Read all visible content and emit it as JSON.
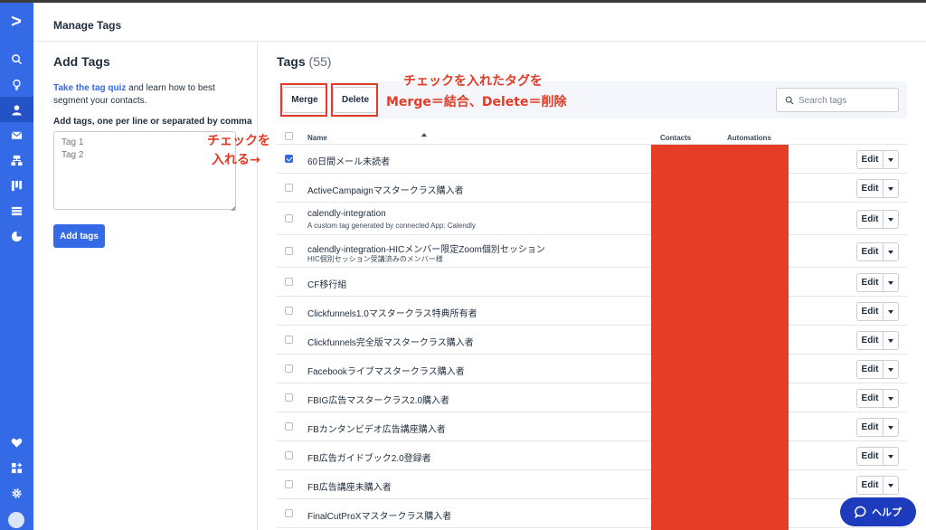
{
  "header": {
    "title": "Manage Tags"
  },
  "add_tags": {
    "title": "Add Tags",
    "quiz_link": "Take the tag quiz",
    "desc_rest": " and learn how to best segment your contacts.",
    "input_label": "Add tags, one per line or separated by comma",
    "placeholder": "Tag 1\nTag 2",
    "button": "Add tags"
  },
  "tags": {
    "title": "Tags",
    "count": "(55)",
    "merge_label": "Merge",
    "delete_label": "Delete",
    "search_placeholder": "Search tags",
    "columns": {
      "name": "Name",
      "contacts": "Contacts",
      "automations": "Automations"
    },
    "edit_label": "Edit",
    "rows": [
      {
        "name": "60日間メール未読者",
        "desc": "",
        "checked": true
      },
      {
        "name": "ActiveCampaignマスタークラス購入者",
        "desc": "",
        "checked": false
      },
      {
        "name": "calendly-integration",
        "desc": "A custom tag generated by connected App: Calendly",
        "checked": false
      },
      {
        "name": "calendly-integration-HICメンバー限定Zoom個別セッション",
        "desc": "HIC個別セッション受講済みのメンバー様",
        "checked": false
      },
      {
        "name": "CF移行組",
        "desc": "",
        "checked": false
      },
      {
        "name": "Clickfunnels1.0マスタークラス特典所有者",
        "desc": "",
        "checked": false
      },
      {
        "name": "Clickfunnels完全版マスタークラス購入者",
        "desc": "",
        "checked": false
      },
      {
        "name": "Facebookライブマスタークラス購入者",
        "desc": "",
        "checked": false
      },
      {
        "name": "FBIG広告マスタークラス2.0購入者",
        "desc": "",
        "checked": false
      },
      {
        "name": "FBカンタンビデオ広告講座購入者",
        "desc": "",
        "checked": false
      },
      {
        "name": "FB広告ガイドブック2.0登録者",
        "desc": "",
        "checked": false
      },
      {
        "name": "FB広告講座未購入者",
        "desc": "",
        "checked": false
      },
      {
        "name": "FinalCutProXマスタークラス購入者",
        "desc": "",
        "checked": false
      }
    ]
  },
  "annotations": {
    "line1": "チェックを入れたタグを",
    "line2": "Merge＝結合、Delete＝削除",
    "check_line1": "チェックを",
    "check_line2": "入れる→"
  },
  "help": {
    "label": "ヘルプ"
  },
  "colors": {
    "accent": "#356ae6",
    "annotation": "#e23b26",
    "help": "#1c3bbd"
  }
}
